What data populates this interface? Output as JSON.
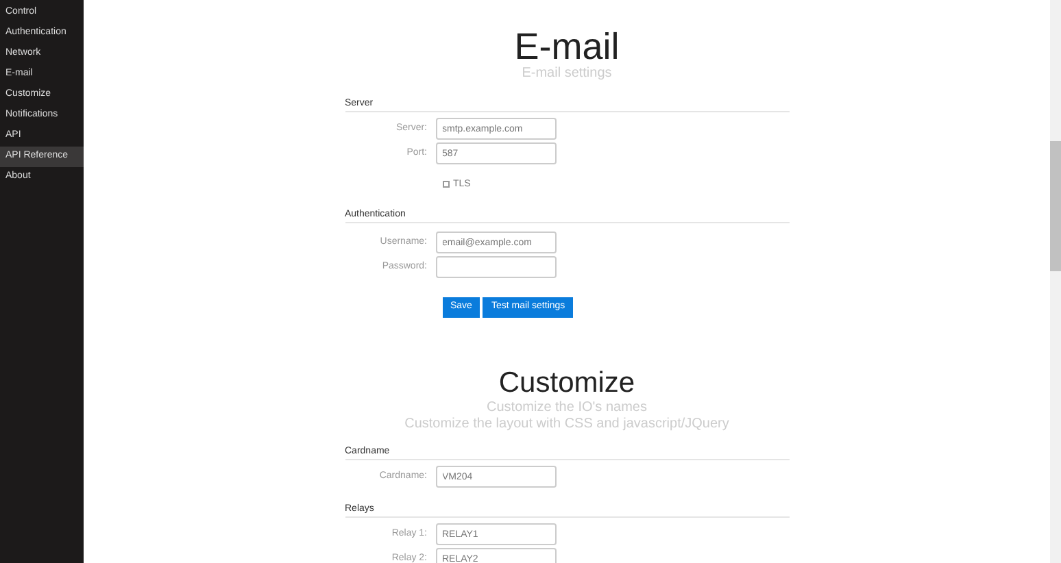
{
  "sidebar": {
    "items": [
      {
        "label": "Control",
        "selected": false
      },
      {
        "label": "Authentication",
        "selected": false
      },
      {
        "label": "Network",
        "selected": false
      },
      {
        "label": "E-mail",
        "selected": false
      },
      {
        "label": "Customize",
        "selected": false
      },
      {
        "label": "Notifications",
        "selected": false
      },
      {
        "label": "API",
        "selected": false
      },
      {
        "label": "API Reference",
        "selected": true
      },
      {
        "label": "About",
        "selected": false
      }
    ]
  },
  "email": {
    "title": "E-mail",
    "subtitle": "E-mail settings",
    "server": {
      "heading": "Server",
      "fields": [
        {
          "label": "Server:",
          "value": "smtp.example.com"
        },
        {
          "label": "Port:",
          "value": "587"
        }
      ],
      "tls": {
        "label": "TLS",
        "checked": false
      }
    },
    "authentication": {
      "heading": "Authentication",
      "fields": [
        {
          "label": "Username:",
          "value": "email@example.com"
        },
        {
          "label": "Password:"
        }
      ]
    },
    "buttons": [
      "Save",
      "Test mail settings"
    ]
  },
  "customize": {
    "title": "Customize",
    "subtitles": [
      "Customize the IO's names",
      "Customize the layout with CSS and javascript/JQuery"
    ],
    "cardname": {
      "heading": "Cardname",
      "fields": [
        {
          "label": "Cardname:",
          "value": "VM204"
        }
      ]
    },
    "relays": {
      "heading": "Relays",
      "fields": [
        {
          "label": "Relay 1:",
          "value": "RELAY1"
        },
        {
          "label": "Relay 2:",
          "value": "RELAY2"
        }
      ]
    }
  }
}
